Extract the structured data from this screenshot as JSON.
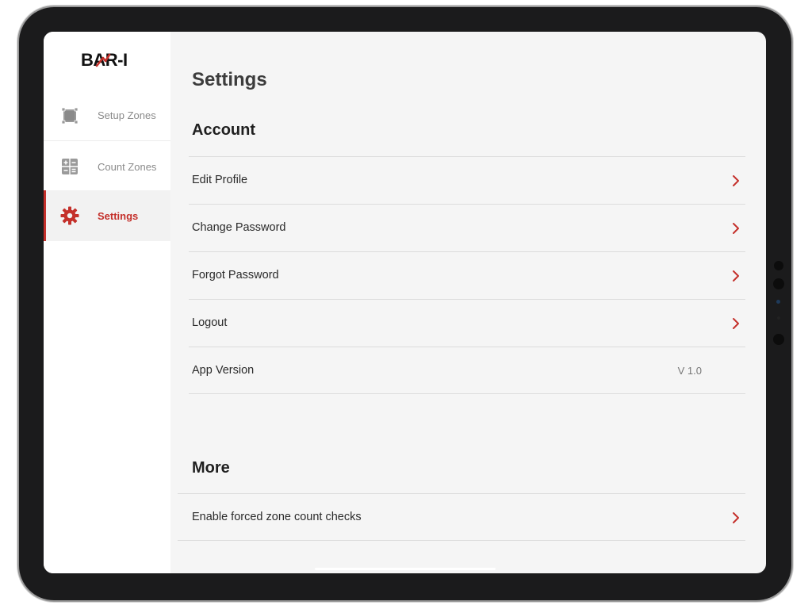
{
  "app": {
    "logo_text": "BAR-I"
  },
  "sidebar": {
    "items": [
      {
        "label": "Setup Zones",
        "icon": "setup-zones-icon",
        "active": false
      },
      {
        "label": "Count Zones",
        "icon": "calculator-icon",
        "active": false
      },
      {
        "label": "Settings",
        "icon": "gear-icon",
        "active": true
      }
    ]
  },
  "page": {
    "title": "Settings",
    "account": {
      "title": "Account",
      "rows": [
        {
          "label": "Edit Profile",
          "icon": "chevron-right-icon"
        },
        {
          "label": "Change Password",
          "icon": "chevron-right-icon"
        },
        {
          "label": "Forgot Password",
          "icon": "chevron-right-icon"
        },
        {
          "label": "Logout",
          "icon": "chevron-right-icon"
        },
        {
          "label": "App Version",
          "value": "V 1.0"
        }
      ]
    },
    "more": {
      "title": "More",
      "rows": [
        {
          "label": "Enable forced zone count checks",
          "icon": "chevron-right-icon"
        }
      ]
    }
  },
  "colors": {
    "accent": "#c4302b",
    "background": "#f5f5f5",
    "sidebar": "#ffffff",
    "bezel": "#1b1b1c"
  }
}
